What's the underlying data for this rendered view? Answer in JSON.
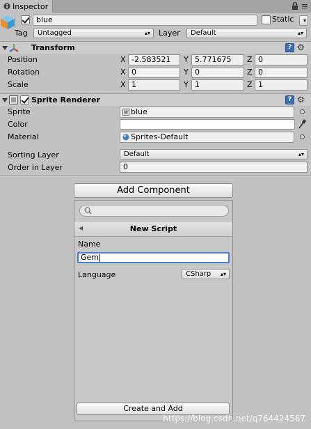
{
  "tab": {
    "label": "Inspector"
  },
  "gameobject": {
    "active": true,
    "name": "blue",
    "static_label": "Static",
    "static": false,
    "tag_label": "Tag",
    "tag_value": "Untagged",
    "layer_label": "Layer",
    "layer_value": "Default"
  },
  "transform": {
    "title": "Transform",
    "rows": [
      {
        "label": "Position",
        "x": "-2.583521",
        "y": "5.771675",
        "z": "0"
      },
      {
        "label": "Rotation",
        "x": "0",
        "y": "0",
        "z": "0"
      },
      {
        "label": "Scale",
        "x": "1",
        "y": "1",
        "z": "1"
      }
    ],
    "axes": [
      "X",
      "Y",
      "Z"
    ]
  },
  "sprite_renderer": {
    "title": "Sprite Renderer",
    "enabled": true,
    "sprite_label": "Sprite",
    "sprite_value": "blue",
    "color_label": "Color",
    "color_value": "#ffffff",
    "material_label": "Material",
    "material_value": "Sprites-Default",
    "sorting_layer_label": "Sorting Layer",
    "sorting_layer_value": "Default",
    "order_label": "Order in Layer",
    "order_value": "0"
  },
  "add_component": {
    "button_label": "Add Component",
    "search_placeholder": "",
    "popup_title": "New Script",
    "name_label": "Name",
    "name_value": "Gem",
    "language_label": "Language",
    "language_value": "CSharp",
    "create_button": "Create and Add"
  },
  "watermark": "https://blog.csdn.net/q764424567",
  "icons": {
    "inspector": "inspector-icon",
    "lock": "lock-icon",
    "cube": "gameobject-cube-icon",
    "transform": "transform-axes-icon",
    "sprite": "sprite-renderer-icon"
  },
  "colors": {
    "background": "#c2c2c2",
    "focus": "#4a7bd4",
    "help": "#3f6fb5"
  }
}
